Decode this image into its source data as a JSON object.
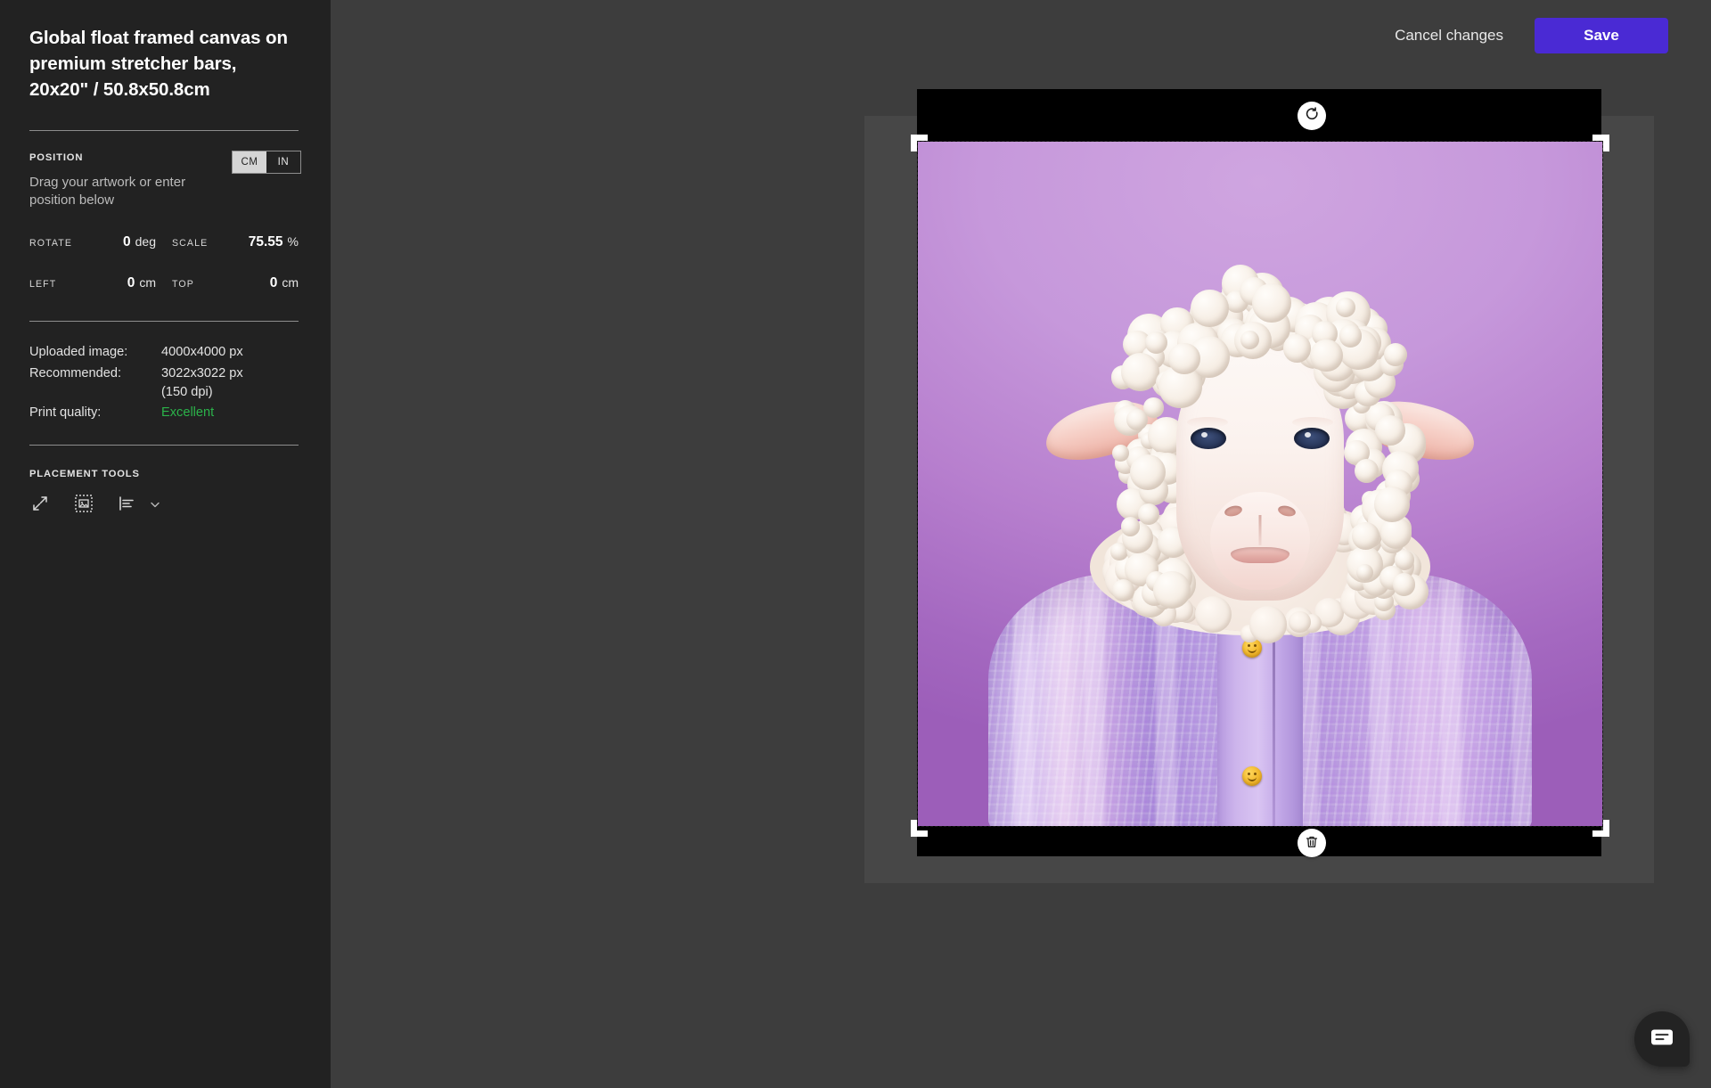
{
  "sidebar": {
    "product_title": "Global float framed canvas on premium stretcher bars, 20x20\" / 50.8x50.8cm",
    "position": {
      "label": "POSITION",
      "hint": "Drag your artwork or enter position below",
      "units": [
        {
          "id": "cm",
          "label": "CM",
          "selected": true
        },
        {
          "id": "in",
          "label": "IN",
          "selected": false
        }
      ]
    },
    "fields": [
      {
        "label": "ROTATE",
        "value": "0",
        "unit": "deg"
      },
      {
        "label": "SCALE",
        "value": "75.55",
        "unit": "%"
      },
      {
        "label": "LEFT",
        "value": "0",
        "unit": "cm"
      },
      {
        "label": "TOP",
        "value": "0",
        "unit": "cm"
      }
    ],
    "info": {
      "uploaded_key": "Uploaded image:",
      "uploaded_val": "4000x4000 px",
      "recommended_key": "Recommended:",
      "recommended_val_1": "3022x3022 px",
      "recommended_val_2": "(150 dpi)",
      "quality_key": "Print quality:",
      "quality_val": "Excellent",
      "quality_color": "#2bb34a"
    },
    "placement_tools": {
      "label": "PLACEMENT TOOLS",
      "items": [
        {
          "icon": "resize-diagonal-icon",
          "name": "scale-to-fit-tool"
        },
        {
          "icon": "fit-image-icon",
          "name": "fit-image-tool"
        },
        {
          "icon": "align-left-icon",
          "name": "align-tool"
        },
        {
          "icon": "chevron-down-icon",
          "name": "align-dropdown"
        }
      ]
    }
  },
  "topbar": {
    "cancel_label": "Cancel changes",
    "save_label": "Save",
    "save_color": "#4a2ad4"
  },
  "canvas": {
    "rotate_button": "rotate-artwork",
    "delete_button": "delete-artwork",
    "frame_color": "#000000",
    "stage_color": "#3d3d3d",
    "artwork": {
      "title": "Sheep in lavender knit cardigan on purple background",
      "background_top_color": "#cfa5e0",
      "background_bottom_color": "#9c5eb9",
      "wool_color": "#f7efe6",
      "cardigan_color": "#b294dc",
      "placket_color": "#d2baee",
      "button_color": "#f2b92e",
      "ear_inner_color": "#edb0a4",
      "eye_color": "#2b3a5e"
    }
  },
  "chat": {
    "name": "chat-widget",
    "icon": "chat-bubble-icon"
  }
}
